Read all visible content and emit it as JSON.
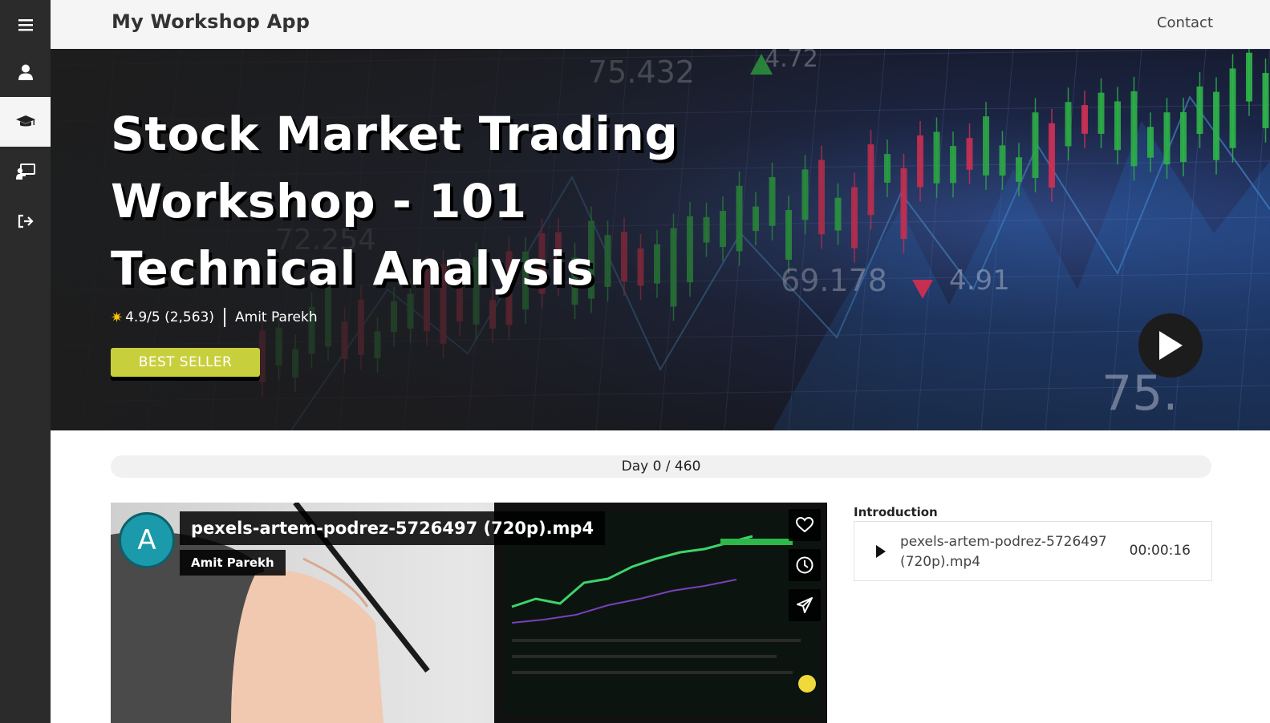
{
  "app": {
    "title": "My Workshop App"
  },
  "nav": {
    "contact": "Contact"
  },
  "sidebar": {
    "items": [
      {
        "icon": "menu-icon"
      },
      {
        "icon": "user-icon"
      },
      {
        "icon": "graduation-cap-icon",
        "active": true
      },
      {
        "icon": "chalkboard-teacher-icon"
      },
      {
        "icon": "sign-out-icon"
      }
    ]
  },
  "hero": {
    "title_lines": [
      "Stock Market Trading",
      "Workshop - 101",
      "Technical Analysis"
    ],
    "rating": "4.9/5 (2,563)",
    "instructor": "Amit Parekh",
    "badge": "BEST SELLER",
    "background_labels": [
      "75.432",
      "4.72",
      "72.254",
      "69.178",
      "4.91",
      "75."
    ],
    "colors": {
      "badge": "#c8cf3c",
      "up_candle": "#2fb84a",
      "down_candle": "#e0325a"
    }
  },
  "progress": {
    "label": "Day 0 / 460",
    "current": 0,
    "total": 460
  },
  "video": {
    "avatar_letter": "A",
    "title": "pexels-artem-podrez-5726497 (720p).mp4",
    "channel": "Amit Parekh",
    "actions": [
      "heart-icon",
      "clock-icon",
      "send-icon"
    ]
  },
  "playlist": {
    "section": "Introduction",
    "items": [
      {
        "title": "pexels-artem-podrez-5726497 (720p).mp4",
        "duration": "00:00:16"
      }
    ]
  }
}
